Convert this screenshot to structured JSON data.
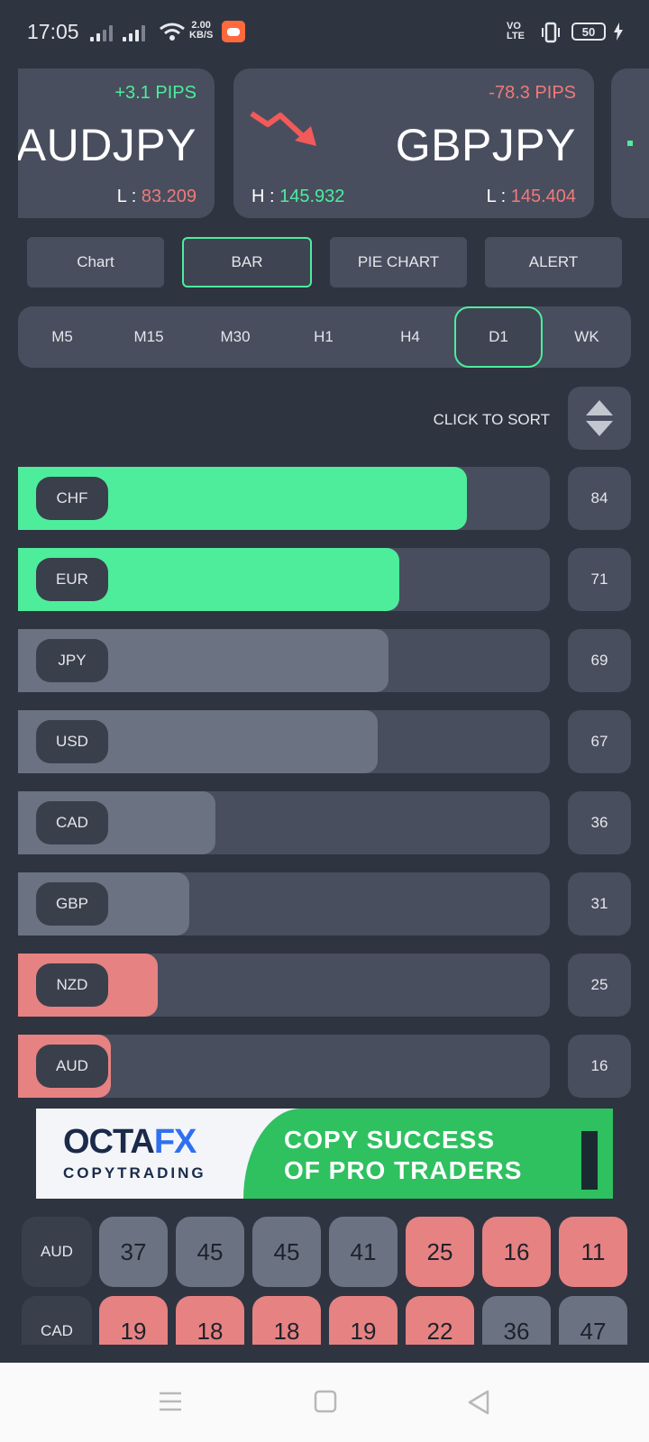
{
  "status": {
    "time": "17:05",
    "speed_top": "2.00",
    "speed_unit": "KB/S",
    "volte": "VO LTE",
    "battery": "50"
  },
  "cards": [
    {
      "pips": "+3.1 PIPS",
      "pair": "AUDJPY",
      "low_label": "L : ",
      "low": "83.209"
    },
    {
      "pips": "-78.3 PIPS",
      "pair": "GBPJPY",
      "high_label": "H : ",
      "high": "145.932",
      "low_label": "L : ",
      "low": "145.404"
    }
  ],
  "tabs": [
    "Chart",
    "BAR",
    "PIE CHART",
    "ALERT"
  ],
  "active_tab": "BAR",
  "timeframes": [
    "M5",
    "M15",
    "M30",
    "H1",
    "H4",
    "D1",
    "WK"
  ],
  "active_timeframe": "D1",
  "sort_label": "CLICK TO SORT",
  "strength": [
    {
      "currency": "CHF",
      "score": "84",
      "value": 84,
      "color": "#4ded9c"
    },
    {
      "currency": "EUR",
      "score": "71",
      "value": 71,
      "color": "#4ded9c"
    },
    {
      "currency": "JPY",
      "score": "69",
      "value": 69,
      "color": "#6b7282"
    },
    {
      "currency": "USD",
      "score": "67",
      "value": 67,
      "color": "#6b7282"
    },
    {
      "currency": "CAD",
      "score": "36",
      "value": 36,
      "color": "#6b7282"
    },
    {
      "currency": "GBP",
      "score": "31",
      "value": 31,
      "color": "#6b7282"
    },
    {
      "currency": "NZD",
      "score": "25",
      "value": 25,
      "color": "#e68282"
    },
    {
      "currency": "AUD",
      "score": "16",
      "value": 16,
      "color": "#e68282"
    }
  ],
  "ad": {
    "brand_a": "OCTA",
    "brand_b": "FX",
    "sub": "COPYTRADING",
    "line1": "COPY SUCCESS",
    "line2": "OF PRO TRADERS"
  },
  "matrix": [
    {
      "label": "AUD",
      "cells": [
        {
          "v": "37",
          "c": "g"
        },
        {
          "v": "45",
          "c": "g"
        },
        {
          "v": "45",
          "c": "g"
        },
        {
          "v": "41",
          "c": "g"
        },
        {
          "v": "25",
          "c": "r"
        },
        {
          "v": "16",
          "c": "r"
        },
        {
          "v": "11",
          "c": "r"
        }
      ]
    },
    {
      "label": "CAD",
      "cells": [
        {
          "v": "19",
          "c": "r"
        },
        {
          "v": "18",
          "c": "r"
        },
        {
          "v": "18",
          "c": "r"
        },
        {
          "v": "19",
          "c": "r"
        },
        {
          "v": "22",
          "c": "r"
        },
        {
          "v": "36",
          "c": "g"
        },
        {
          "v": "47",
          "c": "g"
        }
      ]
    }
  ],
  "colors": {
    "accent": "#4ded9c",
    "negative": "#ef7a7a",
    "panel": "#484e5e",
    "background": "#2f3441"
  }
}
